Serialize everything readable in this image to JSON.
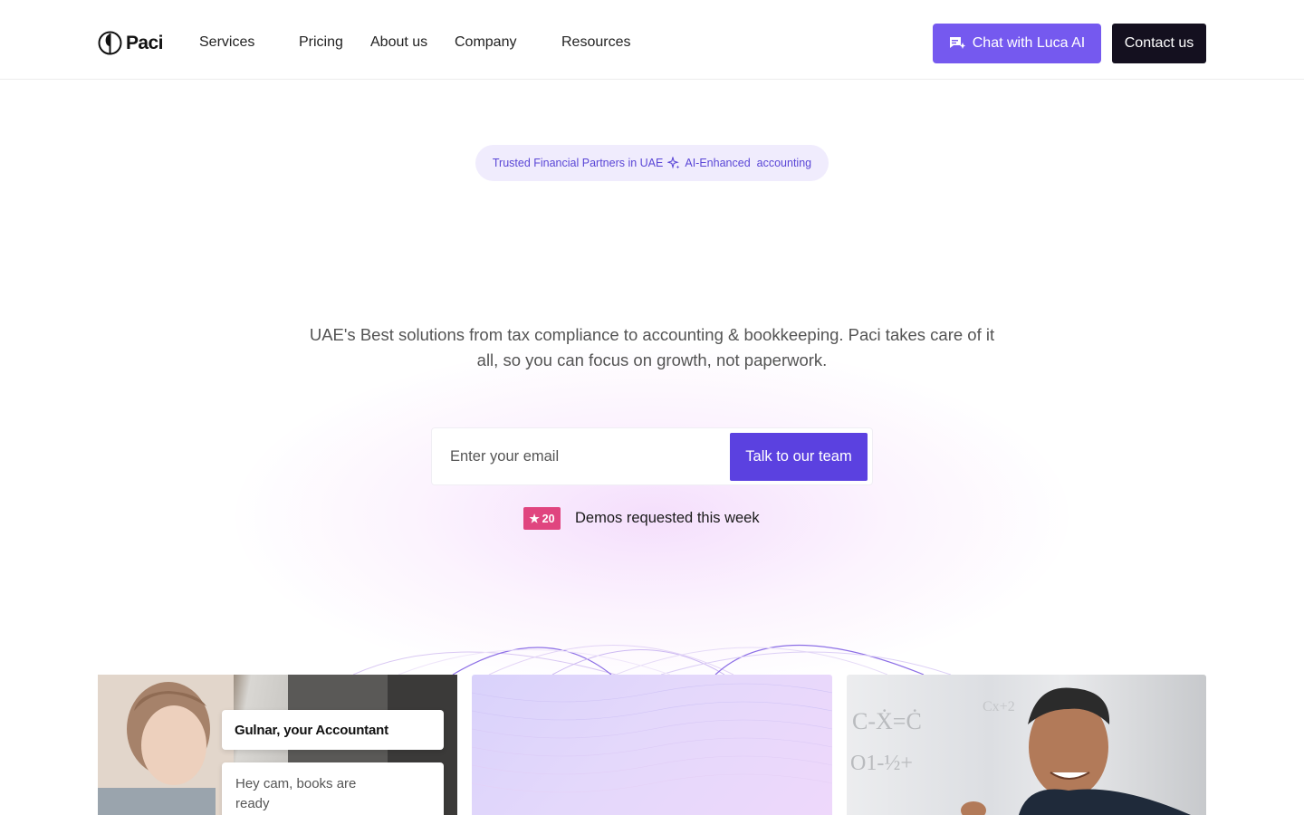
{
  "brand": {
    "name": "Paci"
  },
  "nav": {
    "items": [
      {
        "label": "Services"
      },
      {
        "label": "Pricing"
      },
      {
        "label": "About us"
      },
      {
        "label": "Company"
      },
      {
        "label": "Resources"
      }
    ],
    "chat_button": "Chat with Luca AI",
    "contact_button": "Contact us"
  },
  "hero": {
    "pill": {
      "part1": "Trusted Financial Partners in UAE",
      "part2": "AI-Enhanced",
      "part3": "accounting"
    },
    "subtitle": "UAE's Best solutions from tax compliance to accounting & bookkeeping. Paci takes care of it all, so you can focus on growth, not paperwork.",
    "email_placeholder": "Enter your email",
    "cta_button": "Talk to our team",
    "demos": {
      "badge_count": "20",
      "text": "Demos requested this week"
    }
  },
  "cards": {
    "accountant_name": "Gulnar, your Accountant",
    "accountant_message": "Hey cam, books are ready"
  },
  "colors": {
    "accent": "#5b41e0",
    "luca_button": "#7559ef",
    "contact_button": "#14101f",
    "demo_badge": "#e0457f",
    "pill_bg": "#f0ecfd"
  },
  "icons": [
    "paci-logo-icon",
    "chat-sparkle-icon",
    "sparkle-icon",
    "star-icon"
  ]
}
